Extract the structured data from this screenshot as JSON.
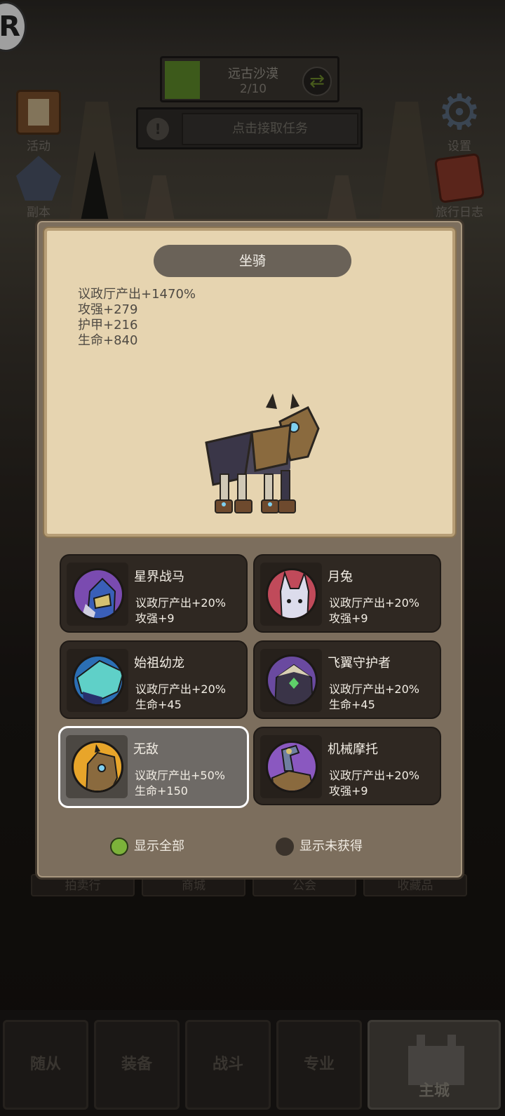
{
  "hud": {
    "badge": "R",
    "zone_name": "远古沙漠",
    "zone_progress": "2/10",
    "zone_progress_fraction": 0.2,
    "task_label": "点击接取任务",
    "task_icon": "!",
    "left_buttons": [
      {
        "label": "活动",
        "icon": "book-icon"
      },
      {
        "label": "副本",
        "icon": "portal-icon"
      }
    ],
    "right_buttons": [
      {
        "label": "设置",
        "icon": "gear-icon"
      },
      {
        "label": "旅行日志",
        "icon": "journal-icon"
      }
    ]
  },
  "background_tabs": [
    "拍卖行",
    "商城",
    "公会",
    "收藏品"
  ],
  "dock": [
    "随从",
    "装备",
    "战斗",
    "专业",
    "主城"
  ],
  "modal": {
    "title": "坐骑",
    "stats": [
      "议政厅产出+1470%",
      "攻强+279",
      "护甲+216",
      "生命+840"
    ],
    "mounts": [
      {
        "name": "星界战马",
        "line1": "议政厅产出+20%",
        "line2": "攻强+9",
        "selected": false,
        "color": "#7a4bb0"
      },
      {
        "name": "月兔",
        "line1": "议政厅产出+20%",
        "line2": "攻强+9",
        "selected": false,
        "color": "#c04a5a"
      },
      {
        "name": "始祖幼龙",
        "line1": "议政厅产出+20%",
        "line2": "生命+45",
        "selected": false,
        "color": "#2b6fb5"
      },
      {
        "name": "飞翼守护者",
        "line1": "议政厅产出+20%",
        "line2": "生命+45",
        "selected": false,
        "color": "#6a4aa0"
      },
      {
        "name": "无敌",
        "line1": "议政厅产出+50%",
        "line2": "生命+150",
        "selected": true,
        "color": "#e8a52a"
      },
      {
        "name": "机械摩托",
        "line1": "议政厅产出+20%",
        "line2": "攻强+9",
        "selected": false,
        "color": "#8a58c0"
      }
    ],
    "filters": [
      {
        "label": "显示全部",
        "active": true
      },
      {
        "label": "显示未获得",
        "active": false
      }
    ]
  }
}
